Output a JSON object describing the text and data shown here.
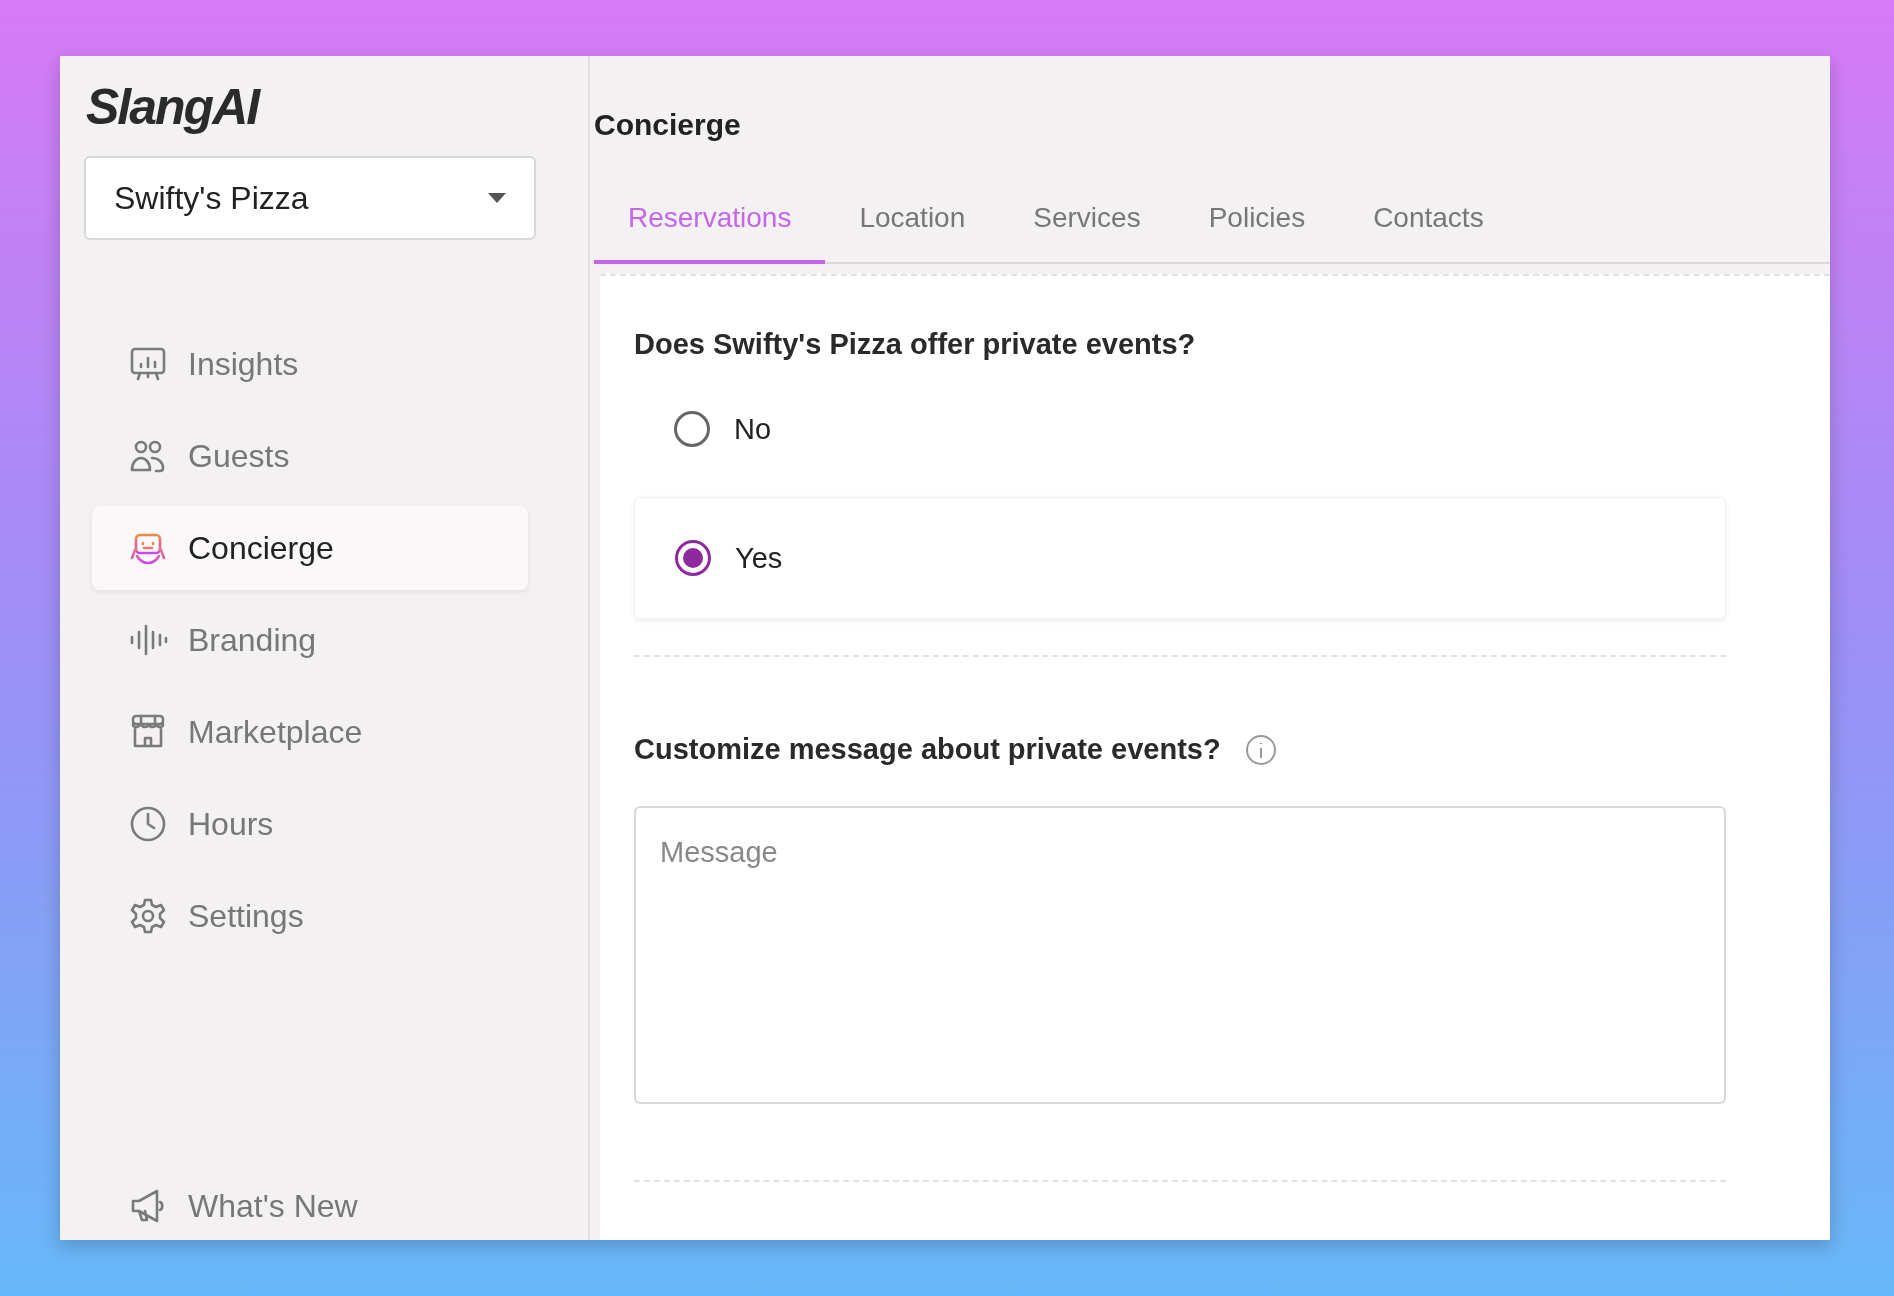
{
  "brand": {
    "logo": "SlangAI"
  },
  "location_select": {
    "value": "Swifty's Pizza"
  },
  "sidebar": {
    "items": [
      {
        "label": "Insights",
        "selected": false
      },
      {
        "label": "Guests",
        "selected": false
      },
      {
        "label": "Concierge",
        "selected": true
      },
      {
        "label": "Branding",
        "selected": false
      },
      {
        "label": "Marketplace",
        "selected": false
      },
      {
        "label": "Hours",
        "selected": false
      },
      {
        "label": "Settings",
        "selected": false
      }
    ],
    "footer_item": {
      "label": "What's New"
    }
  },
  "page": {
    "title": "Concierge",
    "tabs": [
      {
        "label": "Reservations",
        "selected": true
      },
      {
        "label": "Location",
        "selected": false
      },
      {
        "label": "Services",
        "selected": false
      },
      {
        "label": "Policies",
        "selected": false
      },
      {
        "label": "Contacts",
        "selected": false
      }
    ],
    "sections": [
      {
        "kind": "radio",
        "question": "Does Swifty's Pizza offer private events?",
        "options": [
          {
            "label": "No",
            "selected": false
          },
          {
            "label": "Yes",
            "selected": true
          }
        ]
      },
      {
        "kind": "textarea",
        "question": "Customize message about private events?",
        "placeholder": "Message"
      }
    ]
  }
}
